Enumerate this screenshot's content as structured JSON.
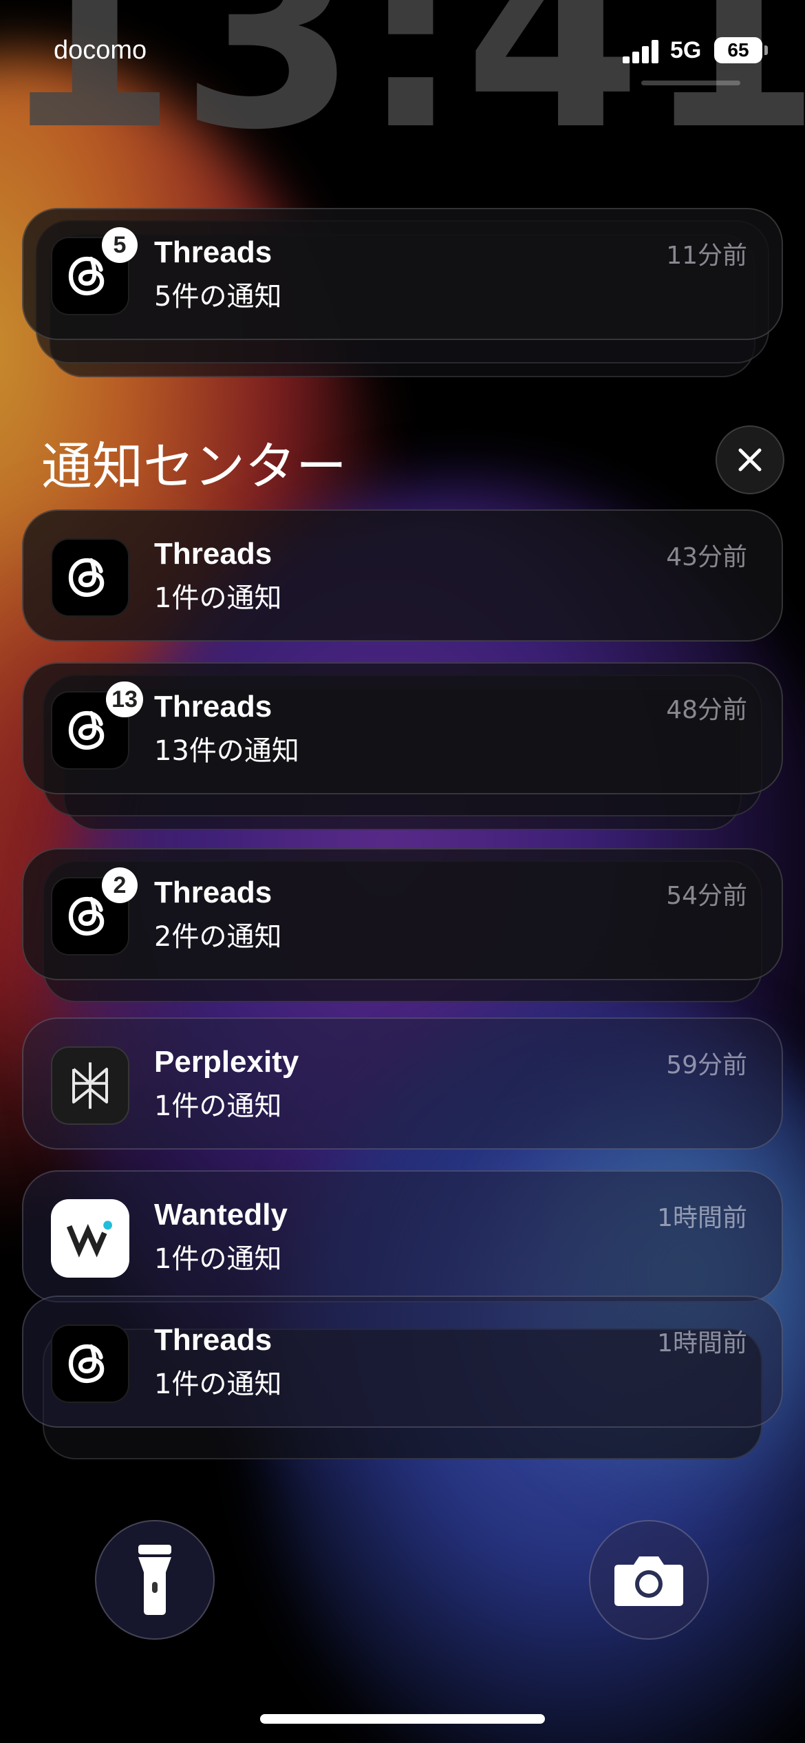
{
  "status_bar": {
    "carrier": "docomo",
    "network": "5G",
    "battery": "65"
  },
  "clock": {
    "time": "13:41"
  },
  "top_notification": {
    "app": "Threads",
    "subtitle": "5件の通知",
    "time": "11分前",
    "badge": "5",
    "icon": "threads-icon"
  },
  "notification_center": {
    "title": "通知センター",
    "close_icon": "close-icon",
    "items": [
      {
        "app": "Threads",
        "subtitle": "1件の通知",
        "time": "43分前",
        "badge": "",
        "icon": "threads-icon"
      },
      {
        "app": "Threads",
        "subtitle": "13件の通知",
        "time": "48分前",
        "badge": "13",
        "icon": "threads-icon"
      },
      {
        "app": "Threads",
        "subtitle": "2件の通知",
        "time": "54分前",
        "badge": "2",
        "icon": "threads-icon"
      },
      {
        "app": "Perplexity",
        "subtitle": "1件の通知",
        "time": "59分前",
        "badge": "",
        "icon": "perplexity-icon"
      },
      {
        "app": "Wantedly",
        "subtitle": "1件の通知",
        "time": "1時間前",
        "badge": "",
        "icon": "wantedly-icon"
      },
      {
        "app": "Threads",
        "subtitle": "1件の通知",
        "time": "1時間前",
        "badge": "",
        "icon": "threads-icon"
      }
    ]
  },
  "bottom_controls": {
    "flashlight": "flashlight-icon",
    "camera": "camera-icon"
  }
}
